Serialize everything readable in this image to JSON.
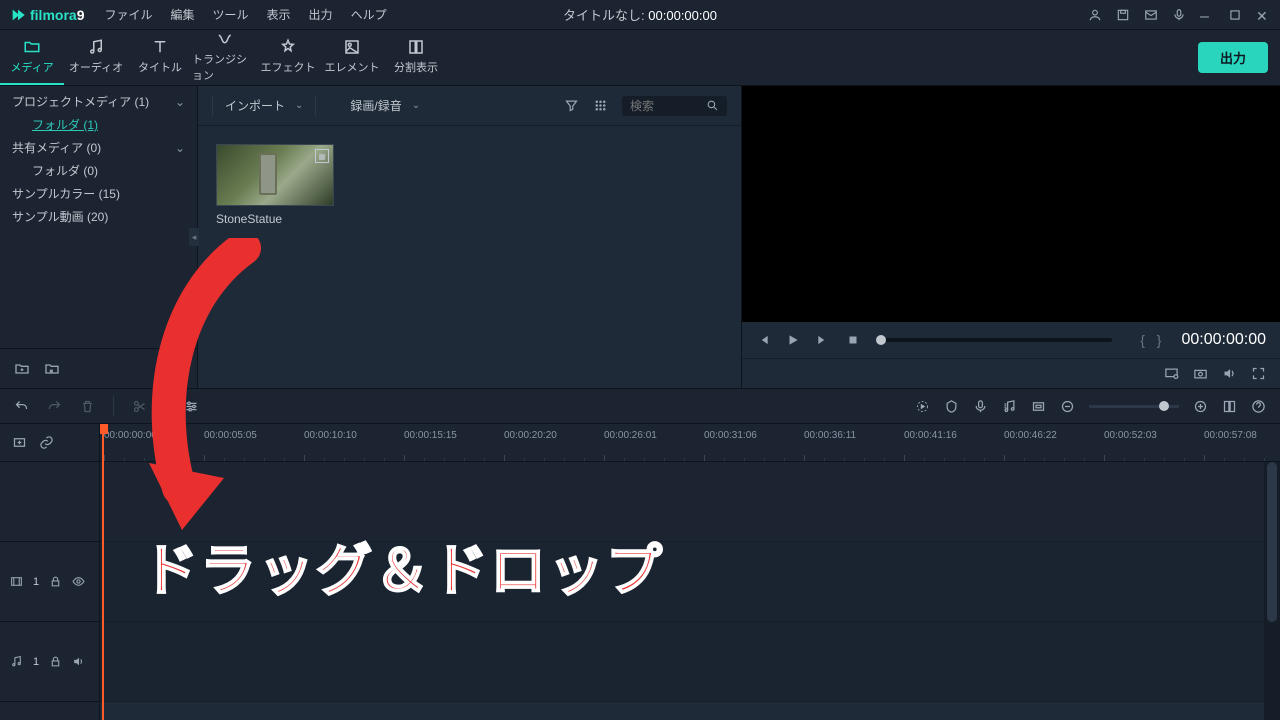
{
  "app": {
    "name": "filmora",
    "ver": "9"
  },
  "menu": [
    "ファイル",
    "編集",
    "ツール",
    "表示",
    "出力",
    "ヘルプ"
  ],
  "titlecenter": {
    "a": "タイトルなし:",
    "b": "00:00:00:00"
  },
  "modetabs": [
    {
      "id": "media",
      "label": "メディア"
    },
    {
      "id": "audio",
      "label": "オーディオ"
    },
    {
      "id": "title",
      "label": "タイトル"
    },
    {
      "id": "transition",
      "label": "トランジション"
    },
    {
      "id": "effect",
      "label": "エフェクト"
    },
    {
      "id": "element",
      "label": "エレメント"
    },
    {
      "id": "split",
      "label": "分割表示"
    }
  ],
  "export_label": "出力",
  "tree": [
    {
      "label": "プロジェクトメディア (1)",
      "chev": true
    },
    {
      "label": "フォルダ (1)",
      "sub": true,
      "link": true
    },
    {
      "label": "共有メディア (0)",
      "chev": true
    },
    {
      "label": "フォルダ (0)",
      "sub": true
    },
    {
      "label": "サンプルカラー (15)"
    },
    {
      "label": "サンプル動画 (20)"
    }
  ],
  "browserbar": {
    "import": "インポート",
    "record": "録画/録音",
    "search_ph": "検索"
  },
  "clip": {
    "name": "StoneStatue"
  },
  "preview": {
    "time": "00:00:00:00",
    "braces": "{ }"
  },
  "timeline": {
    "ticks": [
      "00:00:00:00",
      "00:00:05:05",
      "00:00:10:10",
      "00:00:15:15",
      "00:00:20:20",
      "00:00:26:01",
      "00:00:31:06",
      "00:00:36:11",
      "00:00:41:16",
      "00:00:46:22",
      "00:00:52:03",
      "00:00:57:08"
    ],
    "video_track": "1",
    "audio_track": "1"
  },
  "overlay": "ドラッグ＆ドロップ"
}
